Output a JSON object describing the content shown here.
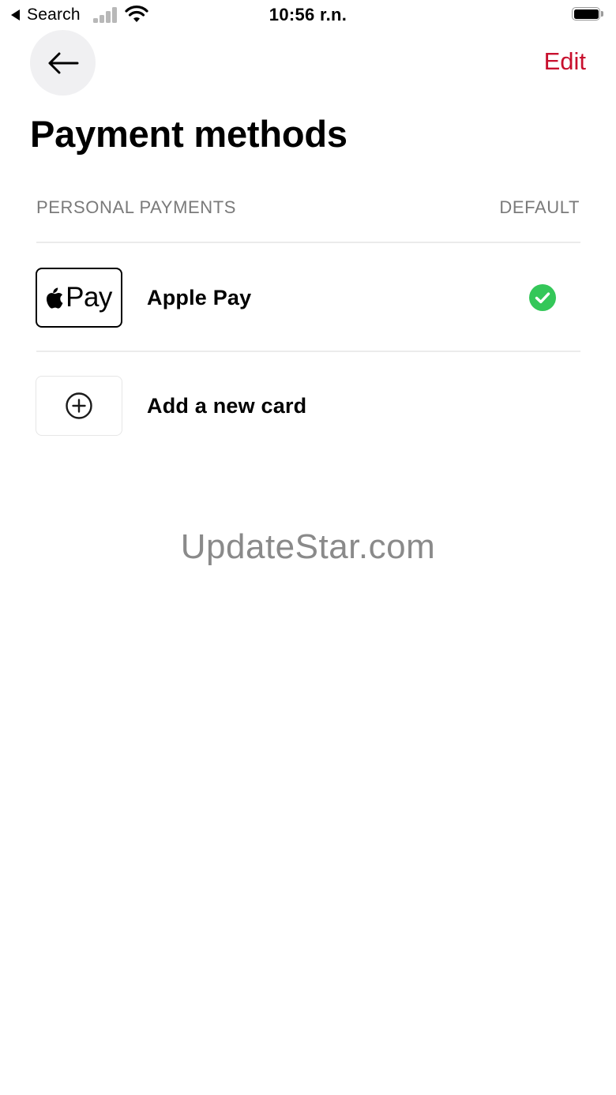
{
  "status_bar": {
    "back_label": "Search",
    "time": "10:56 r.n."
  },
  "header": {
    "edit_label": "Edit",
    "title": "Payment methods"
  },
  "section": {
    "left_label": "PERSONAL PAYMENTS",
    "right_label": "DEFAULT"
  },
  "payment_methods": [
    {
      "badge_text": "Pay",
      "label": "Apple Pay",
      "is_default": true,
      "icon": "apple-logo-icon"
    },
    {
      "label": "Add a new card",
      "icon": "plus-circle-icon"
    }
  ],
  "watermark": "UpdateStar.com",
  "colors": {
    "accent": "#c8102e",
    "default_check": "#34c759",
    "secondary_text": "#7a7a7a"
  }
}
